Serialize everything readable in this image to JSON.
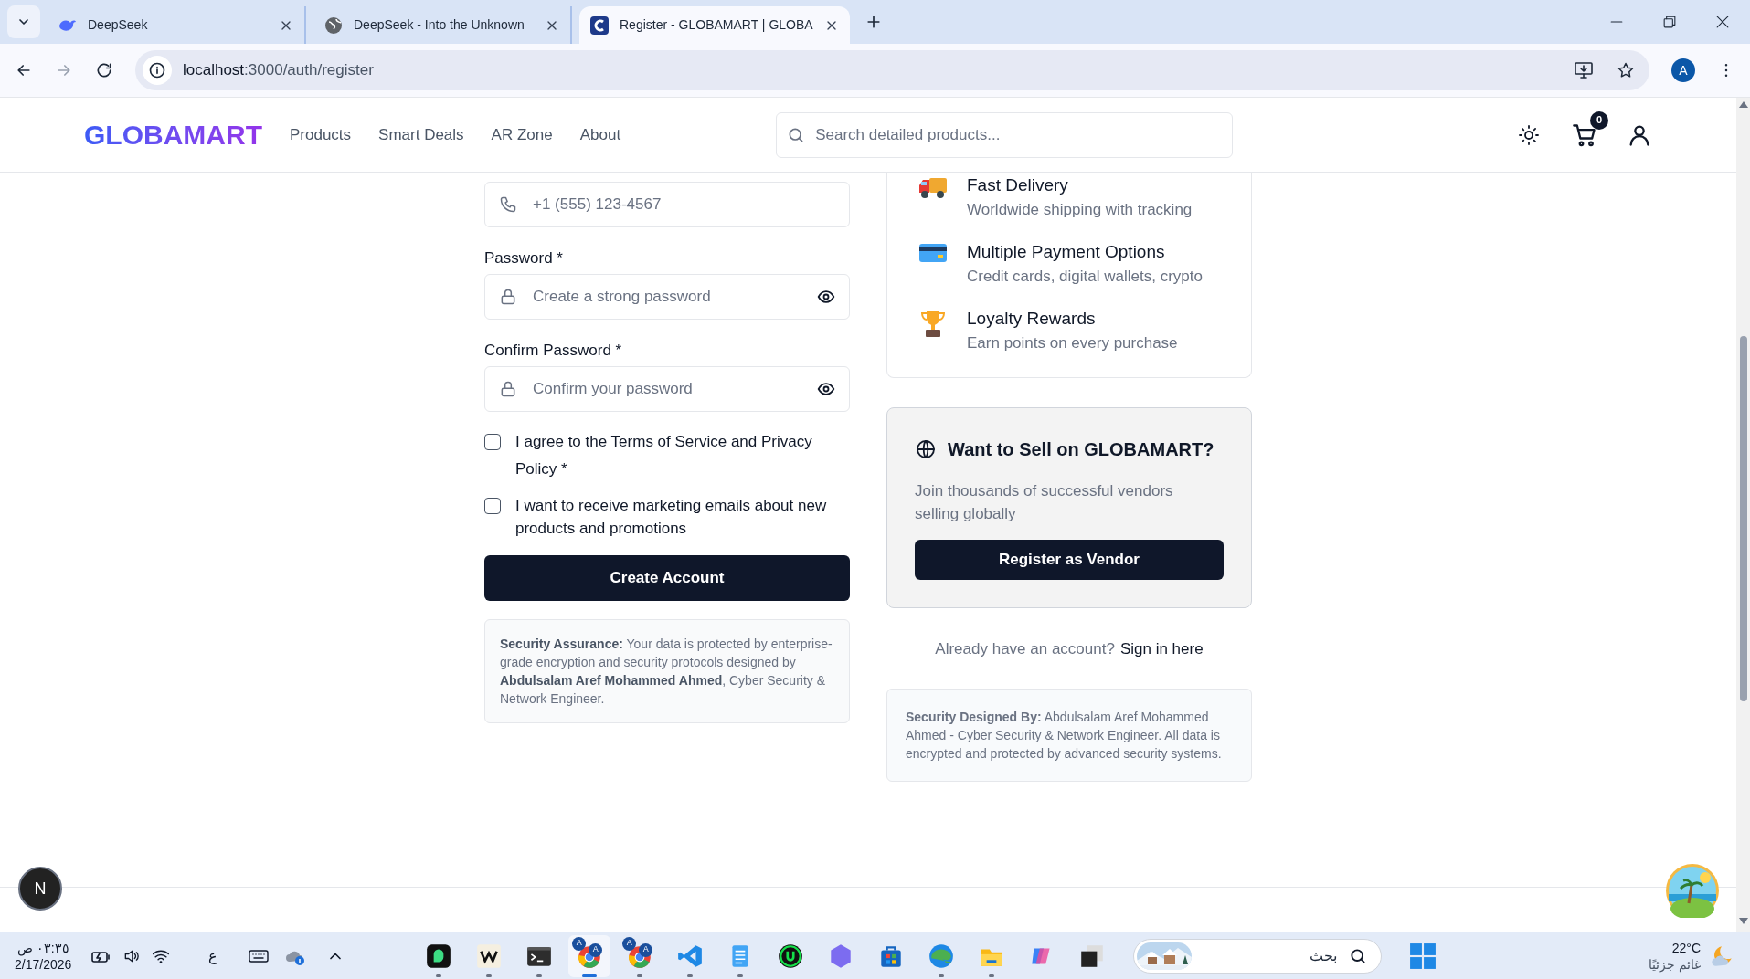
{
  "browser": {
    "tabs": [
      {
        "title": "DeepSeek",
        "selected": false
      },
      {
        "title": "DeepSeek - Into the Unknown",
        "selected": false
      },
      {
        "title": "Register - GLOBAMART | GLOBA",
        "selected": true
      }
    ],
    "address_host": "localhost",
    "address_path": ":3000/auth/register",
    "profile": "A"
  },
  "header": {
    "logo": "GLOBAMART",
    "nav": [
      "Products",
      "Smart Deals",
      "AR Zone",
      "About"
    ],
    "search": {
      "placeholder": "Search detailed products..."
    },
    "cart_count": "0"
  },
  "form": {
    "phone": {
      "placeholder": "+1 (555) 123-4567"
    },
    "fields": [
      {
        "label": "Password *",
        "placeholder": "Create a strong password"
      },
      {
        "label": "Confirm Password *",
        "placeholder": "Confirm your password"
      }
    ],
    "checkboxes": [
      {
        "label": "I agree to the Terms of Service and Privacy Policy *",
        "checked": false
      },
      {
        "label": "I want to receive marketing emails about new products and promotions",
        "checked": false
      }
    ],
    "submit": "Create Account",
    "security_note": "**Security Assurance:** Your data is protected by enterprise-grade encryption and security protocols designed by **Abdulsalam Aref Mohammed Ahmed**, Cyber Security & Network Engineer."
  },
  "features": [
    {
      "kind": "truck",
      "title": "Fast Delivery",
      "description": "Worldwide shipping with tracking"
    },
    {
      "kind": "card",
      "title": "Multiple Payment Options",
      "description": "Credit cards, digital wallets, crypto"
    },
    {
      "kind": "trophy",
      "title": "Loyalty Rewards",
      "description": "Earn points on every purchase"
    }
  ],
  "vendor": {
    "title": "Want to Sell on GLOBAMART?",
    "description": "Join thousands of successful vendors selling globally",
    "button": "Register as Vendor"
  },
  "signin": {
    "prompt": "Already have an account?",
    "link": "Sign in here"
  },
  "security_designed": "**Security Designed By:** Abdulsalam Aref Mohammed Ahmed - Cyber Security & Network Engineer. All data is encrypted and protected by advanced security systems.",
  "dev_badge": "N",
  "taskbar": {
    "time": "٠٣:٣٥ ص",
    "date": "2/17/2026",
    "language": "ع",
    "apps": [
      {
        "kind": "chat",
        "running": true,
        "selected": false
      },
      {
        "kind": "zigzag",
        "running": true,
        "selected": false
      },
      {
        "kind": "terminal",
        "running": true,
        "selected": false
      },
      {
        "kind": "chrome",
        "running": true,
        "selected": true,
        "badges": [
          "A",
          "A"
        ]
      },
      {
        "kind": "chrome",
        "running": true,
        "selected": false,
        "badges": [
          "A",
          "A"
        ]
      },
      {
        "kind": "vscode",
        "running": true,
        "selected": false
      },
      {
        "kind": "notepad",
        "running": true,
        "selected": false
      },
      {
        "kind": "greencircle",
        "running": false,
        "selected": false
      },
      {
        "kind": "hexagon",
        "running": false,
        "selected": false
      },
      {
        "kind": "store",
        "running": false,
        "selected": false
      },
      {
        "kind": "edge",
        "running": true,
        "selected": false
      },
      {
        "kind": "folder",
        "running": true,
        "selected": false
      },
      {
        "kind": "copilot",
        "running": false,
        "selected": false
      },
      {
        "kind": "square",
        "running": false,
        "selected": false
      }
    ],
    "search": {
      "placeholder": "بحث"
    },
    "temperature": "22°C",
    "weather": "غائم جزئيًا"
  }
}
